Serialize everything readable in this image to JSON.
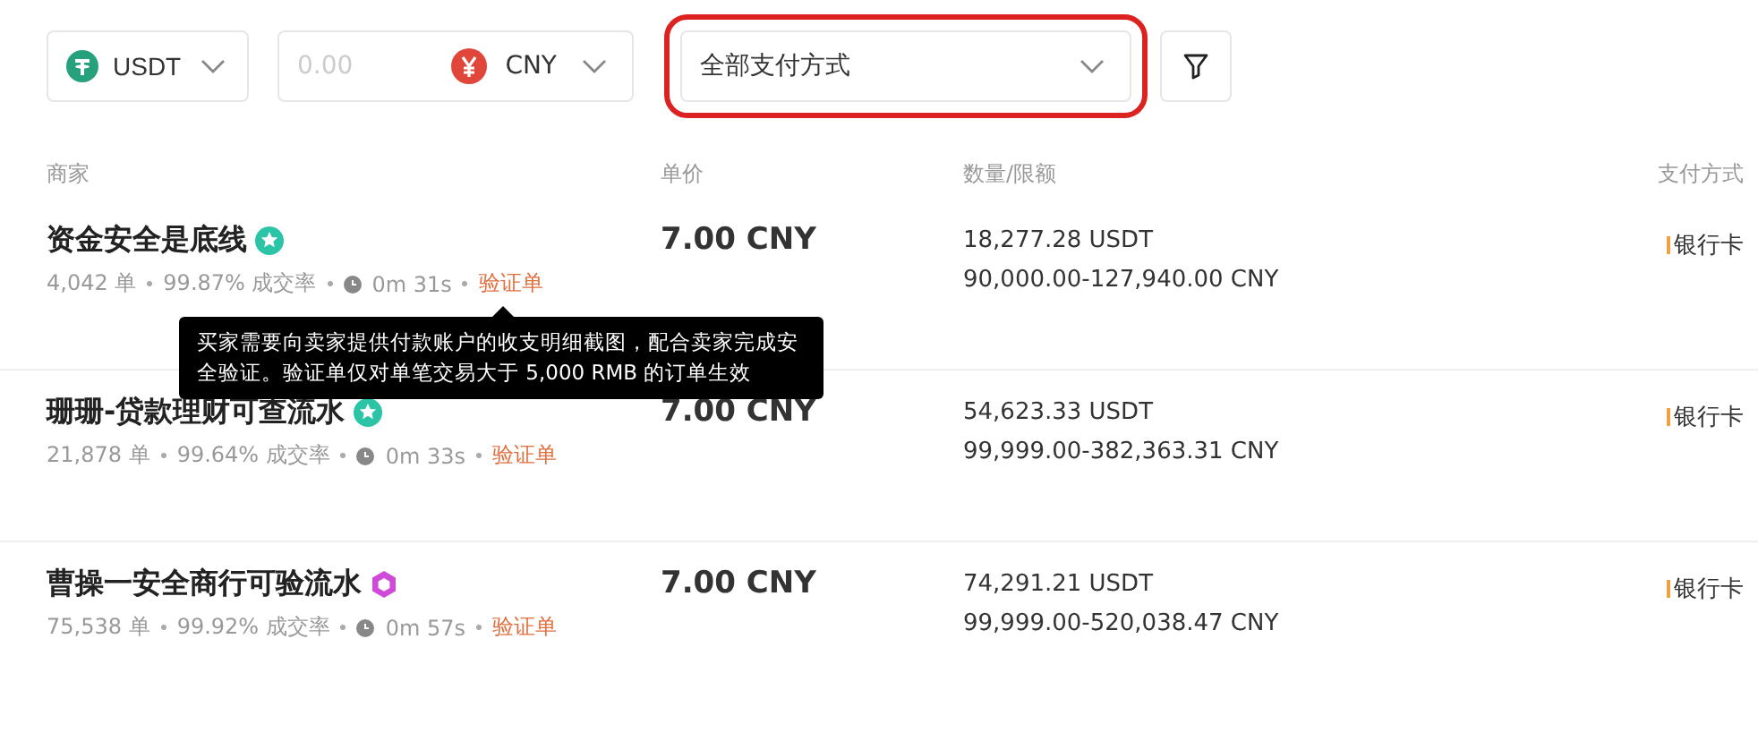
{
  "filters": {
    "crypto": {
      "label": "USDT"
    },
    "amount": {
      "placeholder": "0.00",
      "currency": "CNY"
    },
    "payment": {
      "label": "全部支付方式",
      "highlighted": true
    }
  },
  "columns": [
    "商家",
    "单价",
    "数量/限额",
    "支付方式"
  ],
  "rows": [
    {
      "name": "资金安全是底线",
      "kind": "star",
      "orders": "4,042 单",
      "rate": "99.87% 成交率",
      "time": "0m 31s",
      "tag": "验证单",
      "price": "7.00 CNY",
      "available": "18,277.28 USDT",
      "limit": "90,000.00-127,940.00 CNY",
      "payment": "银行卡"
    },
    {
      "name": "珊珊-贷款理财可查流水",
      "kind": "star",
      "orders": "21,878 单",
      "rate": "99.64% 成交率",
      "time": "0m 33s",
      "tag": "验证单",
      "price": "7.00 CNY",
      "available": "54,623.33 USDT",
      "limit": "99,999.00-382,363.31 CNY",
      "payment": "银行卡"
    },
    {
      "name": "曹操一安全商行可验流水",
      "kind": "hexagon",
      "orders": "75,538 单",
      "rate": "99.92% 成交率",
      "time": "0m 57s",
      "tag": "验证单",
      "price": "7.00 CNY",
      "available": "74,291.21 USDT",
      "limit": "99,999.00-520,038.47 CNY",
      "payment": "银行卡"
    }
  ],
  "tooltip": {
    "text": "买家需要向卖家提供付款账户的收支明细截图，配合卖家完成安全验证。验证单仅对单笔交易大于 5,000 RMB 的订单生效"
  }
}
